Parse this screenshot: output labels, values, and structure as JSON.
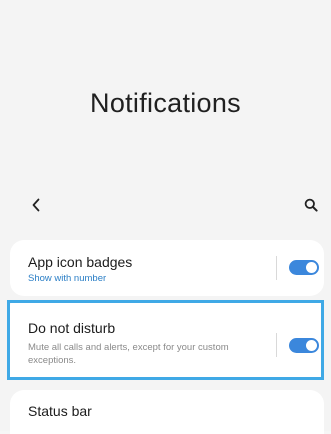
{
  "header": {
    "title": "Notifications"
  },
  "toolbar": {
    "back_icon": "chevron-left-icon",
    "search_icon": "search-icon"
  },
  "settings": {
    "app_icon_badges": {
      "title": "App icon badges",
      "subtitle": "Show with number",
      "enabled": true
    },
    "do_not_disturb": {
      "title": "Do not disturb",
      "description": "Mute all calls and alerts, except for your custom exceptions.",
      "enabled": true
    },
    "status_bar": {
      "title": "Status bar"
    }
  },
  "colors": {
    "accent": "#3b87dc",
    "highlight": "#3fa9e6",
    "subtitle": "#2a7ec6"
  }
}
